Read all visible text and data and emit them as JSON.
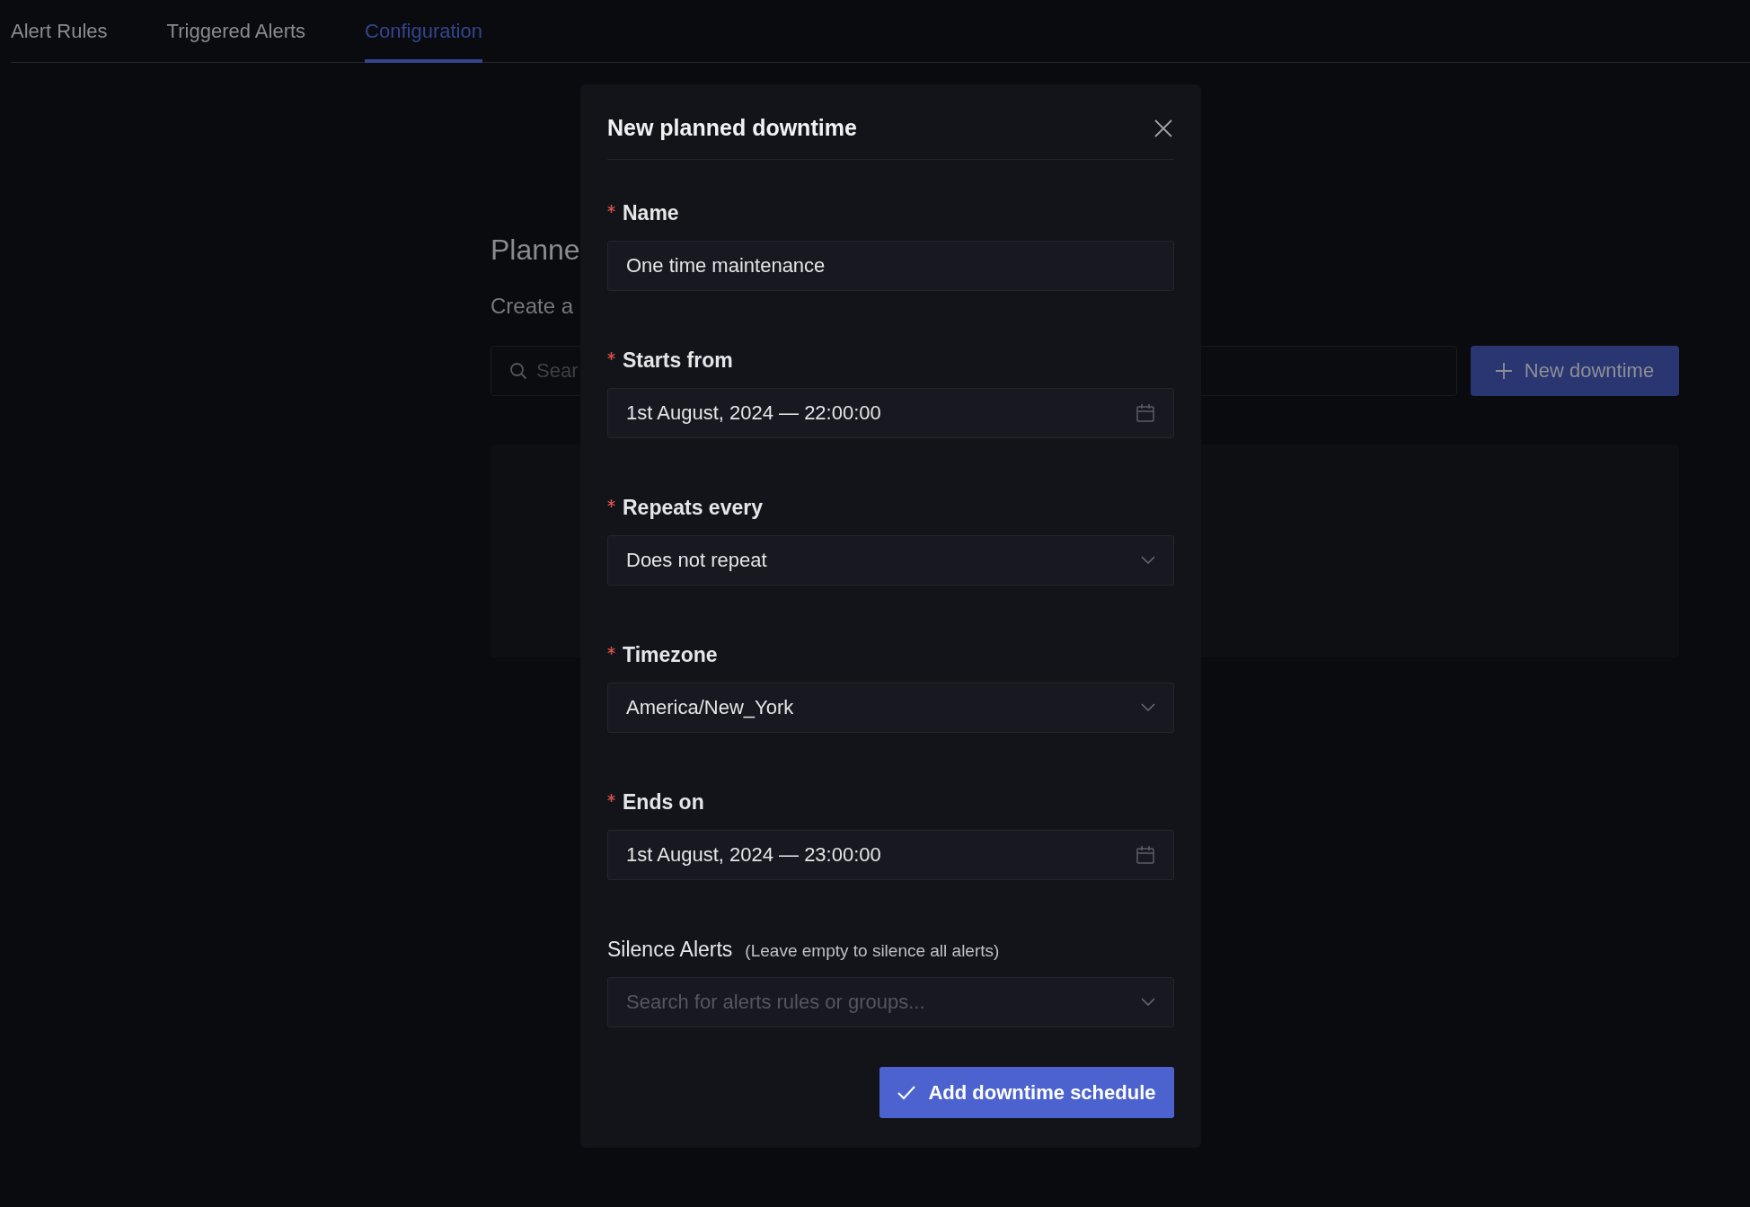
{
  "tabs": [
    {
      "label": "Alert Rules",
      "selected": false
    },
    {
      "label": "Triggered Alerts",
      "selected": false
    },
    {
      "label": "Configuration",
      "selected": true
    }
  ],
  "background": {
    "title": "Planne",
    "subtitle": "Create a",
    "search": {
      "placeholder": "Sear"
    },
    "new_button": "New downtime"
  },
  "dialog": {
    "title": "New planned downtime",
    "fields": [
      {
        "kind": "text",
        "label": "Name",
        "required": true,
        "value": "One time maintenance"
      },
      {
        "kind": "date",
        "label": "Starts from",
        "required": true,
        "value": "1st August, 2024 — 22:00:00"
      },
      {
        "kind": "select",
        "label": "Repeats every",
        "required": true,
        "value": "Does not repeat"
      },
      {
        "kind": "select",
        "label": "Timezone",
        "required": true,
        "value": "America/New_York"
      },
      {
        "kind": "date",
        "label": "Ends on",
        "required": true,
        "value": "1st August, 2024 — 23:00:00"
      },
      {
        "kind": "select",
        "label": "Silence Alerts",
        "required": false,
        "hint": "(Leave empty to silence all alerts)",
        "placeholder": "Search for alerts rules or groups..."
      }
    ],
    "submit": "Add downtime schedule"
  }
}
